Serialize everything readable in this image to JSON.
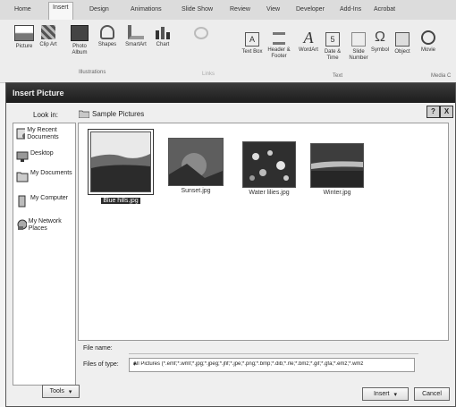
{
  "ribbon": {
    "tabs": [
      "Home",
      "Insert",
      "Design",
      "Animations",
      "Slide Show",
      "Review",
      "View",
      "Developer",
      "Add-Ins",
      "Acrobat"
    ],
    "active_tab": "Insert",
    "buttons": {
      "picture": "Picture",
      "clip_art": "Clip Art",
      "photo_album": "Photo Album",
      "shapes": "Shapes",
      "smartart": "SmartArt",
      "chart": "Chart",
      "text_box": "Text Box",
      "header_footer": "Header & Footer",
      "wordart": "WordArt",
      "date_time": "Date & Time",
      "slide_number": "Slide Number",
      "symbol": "Symbol",
      "object": "Object",
      "movie": "Movie"
    },
    "groups": {
      "illustrations": "Illustrations",
      "links": "Links",
      "text": "Text",
      "media": "Media C"
    }
  },
  "dialog": {
    "title": "Insert Picture",
    "help_label": "?",
    "close_label": "X",
    "look_in_label": "Look in:",
    "folder": "Sample Pictures",
    "toolbar_icons": "· ◈ · ⍋ ✕ ⊟ ⊞ ·",
    "places": [
      "My Recent Documents",
      "Desktop",
      "My Documents",
      "My Computer",
      "My Network Places"
    ],
    "files": [
      {
        "name": "Blue hills.jpg",
        "selected": true
      },
      {
        "name": "Sunset.jpg",
        "selected": false
      },
      {
        "name": "Water lilies.jpg",
        "selected": false
      },
      {
        "name": "Winter.jpg",
        "selected": false
      }
    ],
    "file_name_label": "File name:",
    "file_name_value": "",
    "file_type_label": "Files of type:",
    "file_type_value": "All Pictures (*.emf;*.wmf;*.jpg;*.jpeg;*.jfif;*.jpe;*.png;*.bmp;*.dib;*.rle;*.bmz;*.gif;*.gfa;*.emz;*.wmz",
    "tools_label": "Tools",
    "insert_label": "Insert",
    "cancel_label": "Cancel"
  }
}
